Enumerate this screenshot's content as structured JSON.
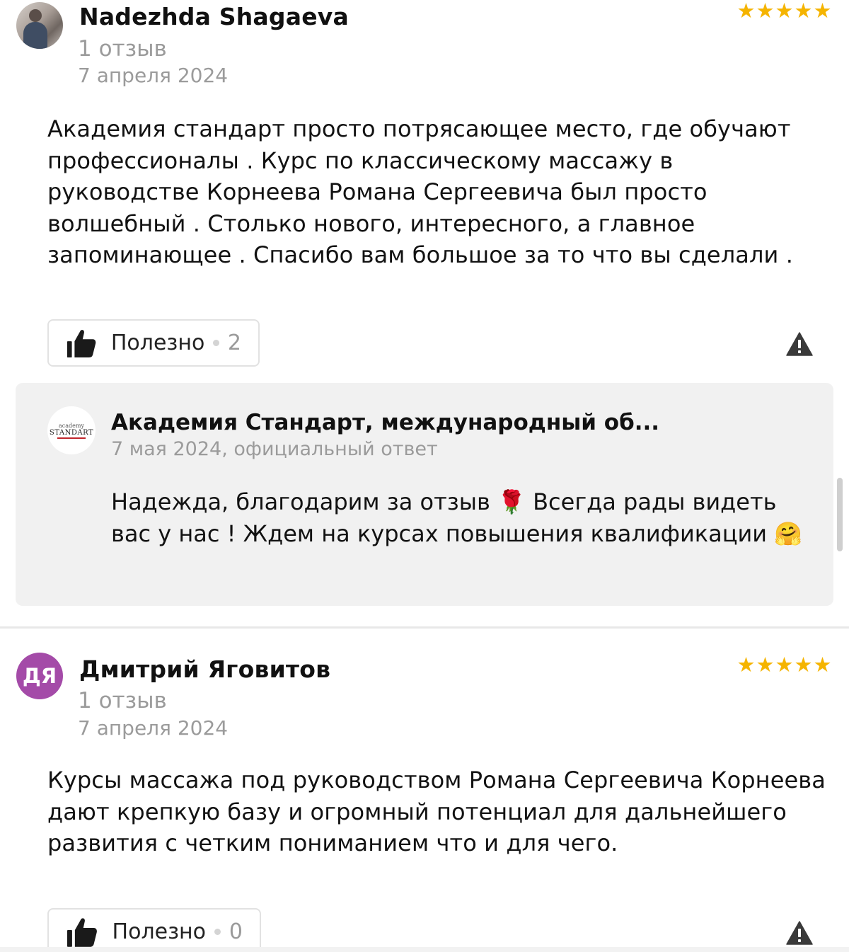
{
  "reviews": [
    {
      "author": "Nadezhda Shagaeva",
      "avatar_icon": "user-photo",
      "review_count": "1 отзыв",
      "date": "7 апреля 2024",
      "rating": 5,
      "stars": [
        "★",
        "★",
        "★",
        "★",
        "★"
      ],
      "text": "Академия стандарт просто потрясающее место, где обучают профессионалы . Курс по классическому массажу в руководстве Корнеева Романа Сергеевича был просто волшебный . Столько нового, интересного, а главное запоминающее . Спасибо вам большое за то что вы сделали .",
      "useful_label": "Полезно",
      "useful_count": "2",
      "reply": {
        "logo_line1": "academy",
        "logo_line2": "STANDART",
        "org_name": "Академия Стандарт, международный об...",
        "meta": "7 мая 2024, официальный ответ",
        "text": "Надежда, благодарим за отзыв 🌹 Всегда рады видеть вас у нас ! Ждем на курсах повышения квалификации 🤗"
      }
    },
    {
      "author": "Дмитрий Яговитов",
      "avatar_initials": "ДЯ",
      "review_count": "1 отзыв",
      "date": "7 апреля 2024",
      "rating": 5,
      "stars": [
        "★",
        "★",
        "★",
        "★",
        "★"
      ],
      "text": "Курсы массажа под руководством Романа Сергеевича Корнеева дают крепкую базу и огромный потенциал для дальнейшего развития с четким пониманием что и для чего.",
      "useful_label": "Полезно",
      "useful_count": "0"
    }
  ],
  "colors": {
    "star": "#f5b400",
    "initials_avatar": "#a44ba8",
    "reply_background": "#f1f1f1",
    "secondary_text": "#9b9b9b"
  },
  "icons": [
    "thumbs-up-icon",
    "warning-triangle-icon",
    "star-icon"
  ]
}
